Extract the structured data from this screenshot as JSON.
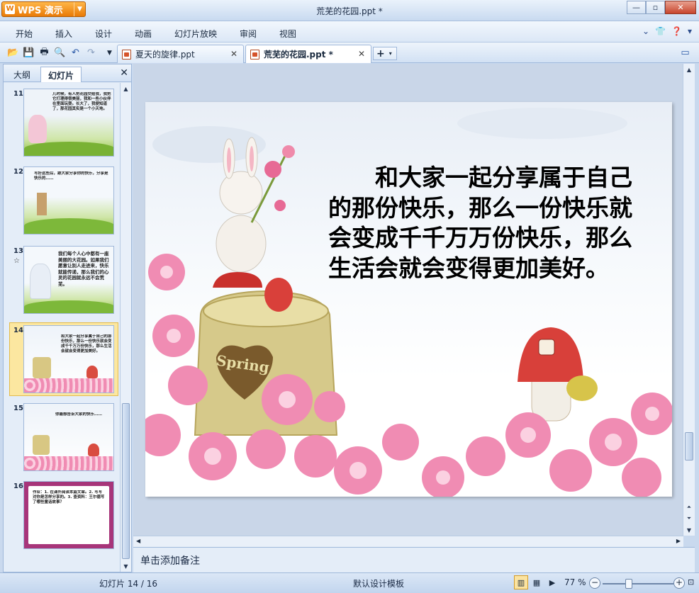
{
  "app": {
    "name": "WPS 演示",
    "window_title": "荒芜的花园.ppt *"
  },
  "menu": [
    "开始",
    "插入",
    "设计",
    "动画",
    "幻灯片放映",
    "审阅",
    "视图"
  ],
  "doc_tabs": [
    {
      "label": "夏天的旋律.ppt",
      "active": false
    },
    {
      "label": "荒芜的花园.ppt *",
      "active": true
    }
  ],
  "panel": {
    "tabs": [
      "大纲",
      "幻灯片"
    ],
    "active_tab": "幻灯片",
    "thumbnails": [
      {
        "number": "11",
        "text": "儿时候，有人把花园交给我，我把它打理得很美丽，我和一些小伙伴在里面玩耍。长大了，我便知道了，那花园其实是一个小天地。"
      },
      {
        "number": "12",
        "text": "写好这些后，跟大家分享你的快乐，分享是快乐的……"
      },
      {
        "number": "13",
        "star": "☆",
        "text": "我们每个人心中都有一座美丽的大花园。如果我们愿意让别人走进来，快乐就能传递，那么我们的心灵的花园就永远不会荒芜。"
      },
      {
        "number": "14",
        "selected": true,
        "text": "和大家一起分享属于自己的那份快乐，那么一份快乐就会变成千千万万份快乐，那么生活会就会变得更加美好。"
      },
      {
        "number": "15",
        "text": "你最想告诉大家的快乐……"
      },
      {
        "number": "16",
        "text": "作业：1. 在课外阅读本篇文章。2. 写写对你是怎样分享的。3. 查资料：王尔德写了哪些童话故事？"
      }
    ]
  },
  "slide": {
    "text": "和大家一起分享属于自己的那份快乐，那么一份快乐就会变成千千万万份快乐，那么生活会就会变得更加美好。",
    "stump_word": "Spring"
  },
  "notes_placeholder": "单击添加备注",
  "status": {
    "slide_counter": "幻灯片 14 / 16",
    "template": "默认设计模板",
    "zoom": "77 %"
  },
  "colors": {
    "accent_orange": "#e97a07",
    "selected_thumb": "#fce7a0"
  },
  "icons": [
    "open-icon",
    "save-icon",
    "print-icon",
    "preview-icon",
    "undo-icon",
    "redo-icon"
  ]
}
